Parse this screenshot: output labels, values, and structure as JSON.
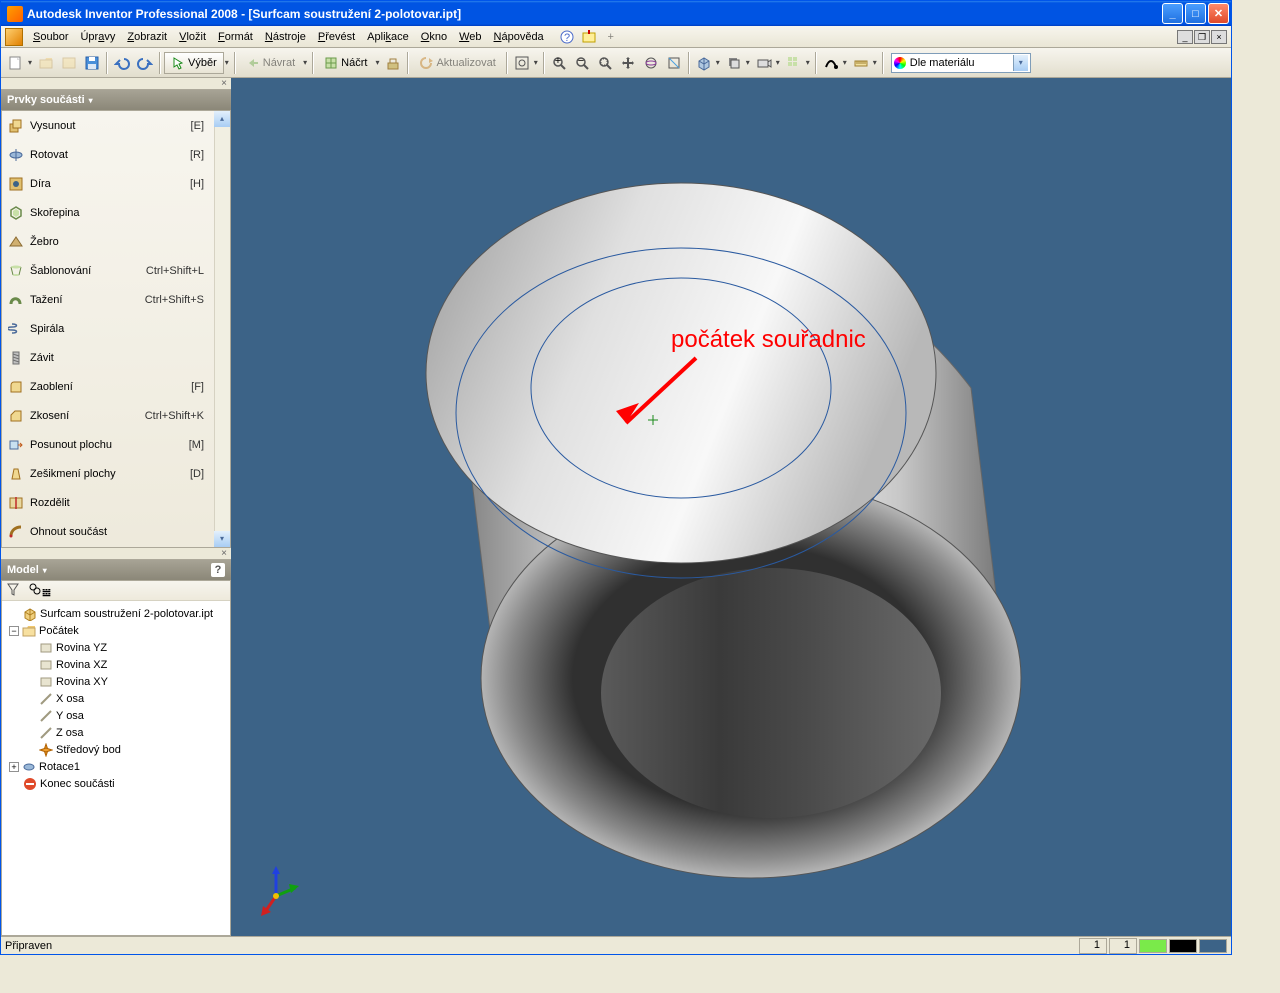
{
  "window": {
    "title": "Autodesk Inventor Professional 2008 - [Surfcam soustružení 2-polotovar.ipt]"
  },
  "menu": {
    "items": [
      "Soubor",
      "Úpravy",
      "Zobrazit",
      "Vložit",
      "Formát",
      "Nástroje",
      "Převést",
      "Aplikace",
      "Okno",
      "Web",
      "Nápověda"
    ]
  },
  "toolbar": {
    "select_label": "Výběr",
    "return_label": "Návrat",
    "sketch_label": "Náčrt",
    "update_label": "Aktualizovat",
    "material_label": "Dle materiálu"
  },
  "features_panel": {
    "title": "Prvky součásti",
    "items": [
      {
        "label": "Vysunout",
        "shortcut": "[E]",
        "icon": "extrude"
      },
      {
        "label": "Rotovat",
        "shortcut": "[R]",
        "icon": "revolve"
      },
      {
        "label": "Díra",
        "shortcut": "[H]",
        "icon": "hole"
      },
      {
        "label": "Skořepina",
        "shortcut": "",
        "icon": "shell"
      },
      {
        "label": "Žebro",
        "shortcut": "",
        "icon": "rib"
      },
      {
        "label": "Šablonování",
        "shortcut": "Ctrl+Shift+L",
        "icon": "loft"
      },
      {
        "label": "Tažení",
        "shortcut": "Ctrl+Shift+S",
        "icon": "sweep"
      },
      {
        "label": "Spirála",
        "shortcut": "",
        "icon": "coil"
      },
      {
        "label": "Závit",
        "shortcut": "",
        "icon": "thread"
      },
      {
        "label": "Zaoblení",
        "shortcut": "[F]",
        "icon": "fillet"
      },
      {
        "label": "Zkosení",
        "shortcut": "Ctrl+Shift+K",
        "icon": "chamfer"
      },
      {
        "label": "Posunout plochu",
        "shortcut": "[M]",
        "icon": "moveface"
      },
      {
        "label": "Zešikmení plochy",
        "shortcut": "[D]",
        "icon": "draft"
      },
      {
        "label": "Rozdělit",
        "shortcut": "",
        "icon": "split"
      },
      {
        "label": "Ohnout součást",
        "shortcut": "",
        "icon": "bend"
      }
    ]
  },
  "model_panel": {
    "title": "Model",
    "root": "Surfcam soustružení 2-polotovar.ipt",
    "origin": {
      "label": "Počátek",
      "children": [
        "Rovina YZ",
        "Rovina XZ",
        "Rovina XY",
        "X osa",
        "Y osa",
        "Z osa",
        "Středový bod"
      ]
    },
    "feature_revolve": "Rotace1",
    "end_of_part": "Konec součásti"
  },
  "viewport": {
    "annotation": "počátek souřadnic"
  },
  "statusbar": {
    "ready": "Připraven",
    "num1": "1",
    "num2": "1"
  }
}
